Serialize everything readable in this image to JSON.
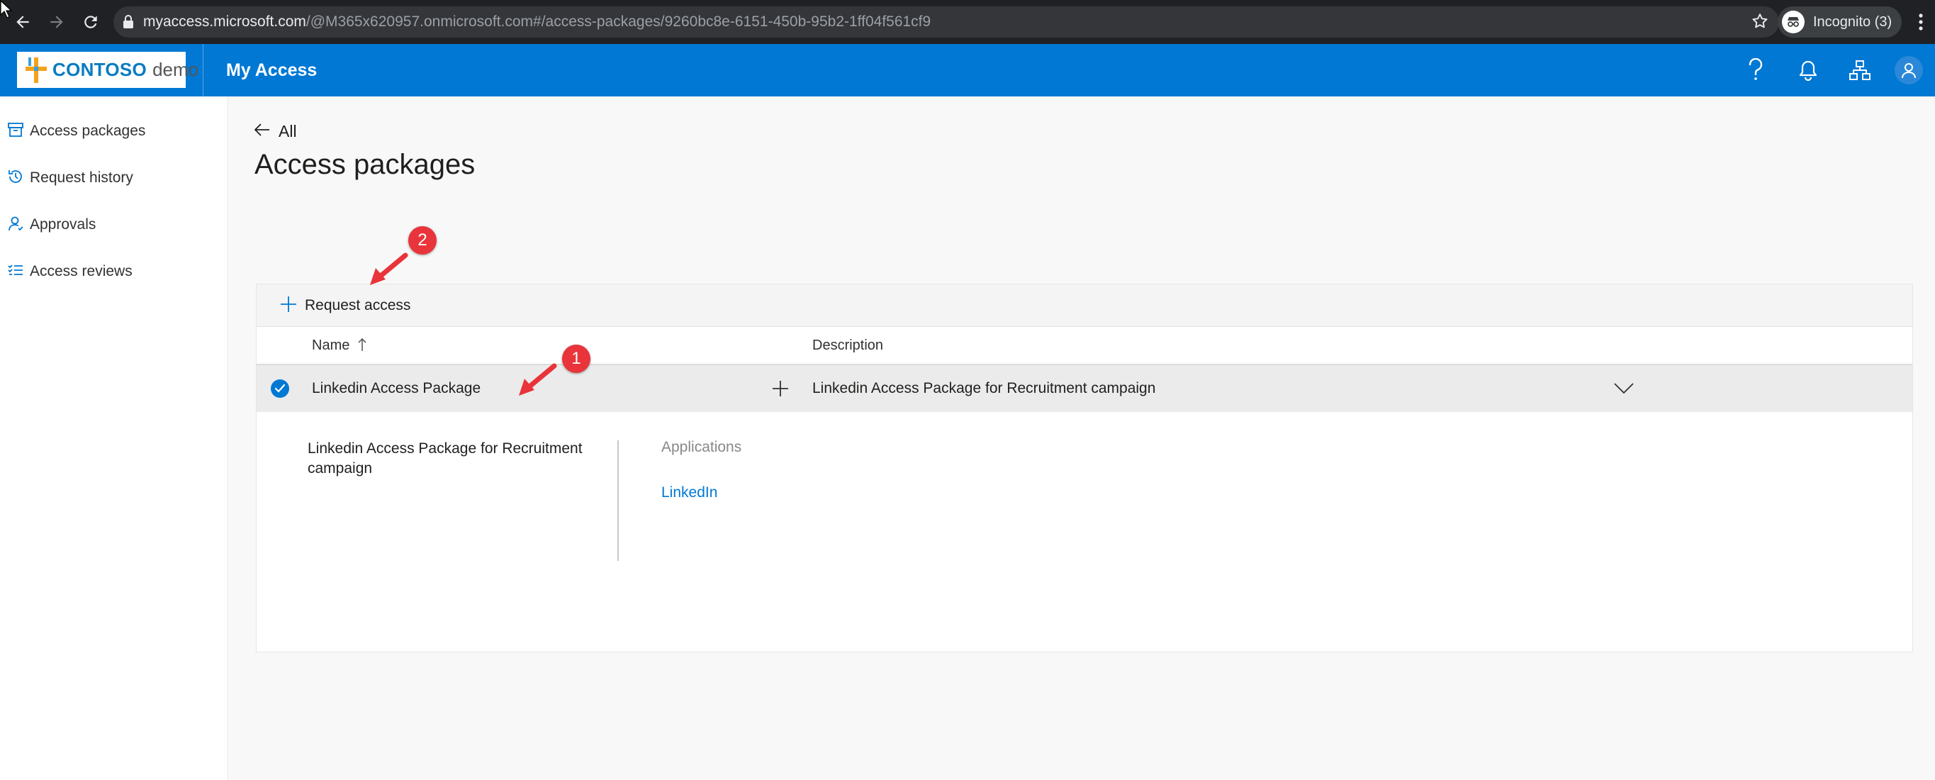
{
  "browser": {
    "url_host": "myaccess.microsoft.com",
    "url_rest": "/@M365x620957.onmicrosoft.com#/access-packages/9260bc8e-6151-450b-95b2-1ff04f561cf9",
    "incognito_label": "Incognito (3)",
    "icons": [
      "back-icon",
      "forward-icon",
      "reload-icon",
      "lock-icon",
      "star-icon",
      "incognito-icon",
      "kebab-icon"
    ]
  },
  "header": {
    "brand": "CONTOSO",
    "brand_suffix": "demo",
    "title": "My Access",
    "accent_color": "#0078d4",
    "icons": [
      "help-icon",
      "bell-icon",
      "org-chart-icon",
      "avatar-icon"
    ]
  },
  "sidebar": {
    "items": [
      {
        "label": "Access packages",
        "icon": "package-icon"
      },
      {
        "label": "Request history",
        "icon": "history-icon"
      },
      {
        "label": "Approvals",
        "icon": "person-icon"
      },
      {
        "label": "Access reviews",
        "icon": "checklist-icon"
      }
    ]
  },
  "main": {
    "back_label": "All",
    "page_title": "Access packages",
    "request_access_label": "Request access",
    "columns": {
      "name": "Name",
      "description": "Description"
    },
    "row": {
      "name": "Linkedin Access Package",
      "description": "Linkedin Access Package for Recruitment campaign",
      "selected": true
    },
    "details": {
      "description": "Linkedin Access Package for Recruitment campaign",
      "applications_heading": "Applications",
      "applications": [
        "LinkedIn"
      ]
    }
  },
  "annotations": {
    "marker_1": "1",
    "marker_2": "2",
    "marker_color": "#e8343a"
  }
}
